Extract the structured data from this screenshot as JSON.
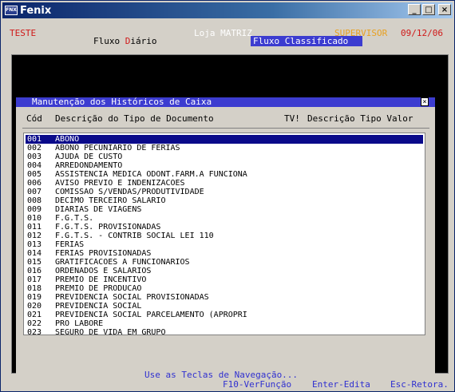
{
  "window": {
    "title": "Fenix",
    "icon_text": "FNX",
    "buttons": {
      "minimize": "_",
      "maximize": "□",
      "close": "×"
    }
  },
  "header": {
    "company": "TESTE",
    "store": "Loja MATRIZ",
    "user": "SUPERVISOR",
    "date": "09/12/06",
    "tab_fluxo_prefix": "Fluxo ",
    "tab_fluxo_hot": "D",
    "tab_fluxo_rest": "iário",
    "tab_classificado": "Fluxo Classificado"
  },
  "dialog": {
    "title": "Manutenção dos Históricos de Caixa",
    "close_glyph": "×",
    "col_code": "Cód",
    "col_desc": "Descrição do Tipo de Documento",
    "col_tv": "TV!",
    "col_tipo": "Descrição Tipo Valor",
    "rows": [
      {
        "code": "001",
        "desc": "ABONO"
      },
      {
        "code": "002",
        "desc": "ABONO PECUNIARIO DE FERIAS"
      },
      {
        "code": "003",
        "desc": "AJUDA DE CUSTO"
      },
      {
        "code": "004",
        "desc": "ARREDONDAMENTO"
      },
      {
        "code": "005",
        "desc": "ASSISTENCIA MEDICA ODONT.FARM.A FUNCIONA"
      },
      {
        "code": "006",
        "desc": "AVISO PREVIO E INDENIZACOES"
      },
      {
        "code": "007",
        "desc": "COMISSAO S/VENDAS/PRODUTIVIDADE"
      },
      {
        "code": "008",
        "desc": "DECIMO TERCEIRO SALARIO"
      },
      {
        "code": "009",
        "desc": "DIARIAS DE VIAGENS"
      },
      {
        "code": "010",
        "desc": "F.G.T.S."
      },
      {
        "code": "011",
        "desc": "F.G.T.S. PROVISIONADAS"
      },
      {
        "code": "012",
        "desc": "F.G.T.S. - CONTRIB SOCIAL LEI 110"
      },
      {
        "code": "013",
        "desc": "FERIAS"
      },
      {
        "code": "014",
        "desc": "FERIAS PROVISIONADAS"
      },
      {
        "code": "015",
        "desc": "GRATIFICACOES A FUNCIONARIOS"
      },
      {
        "code": "016",
        "desc": "ORDENADOS E SALARIOS"
      },
      {
        "code": "017",
        "desc": "PREMIO DE INCENTIVO"
      },
      {
        "code": "018",
        "desc": "PREMIO DE PRODUCAO"
      },
      {
        "code": "019",
        "desc": "PREVIDENCIA SOCIAL PROVISIONADAS"
      },
      {
        "code": "020",
        "desc": "PREVIDENCIA SOCIAL"
      },
      {
        "code": "021",
        "desc": "PREVIDENCIA SOCIAL PARCELAMENTO (APROPRI"
      },
      {
        "code": "022",
        "desc": "PRO LABORE"
      },
      {
        "code": "023",
        "desc": "SEGURO DE VIDA EM GRUPO"
      }
    ],
    "selected_index": 0
  },
  "footer": {
    "nav_hint": "Use as Teclas de Navegação...",
    "f10": "F10-VerFunção",
    "enter": "Enter-Edita",
    "esc": "Esc-Retora."
  },
  "colors": {
    "company": "#d01818",
    "store": "#ffffff",
    "user": "#e8a020",
    "date": "#d01818",
    "accent_blue": "#3c3cd0",
    "selection": "#0a0a8a"
  }
}
